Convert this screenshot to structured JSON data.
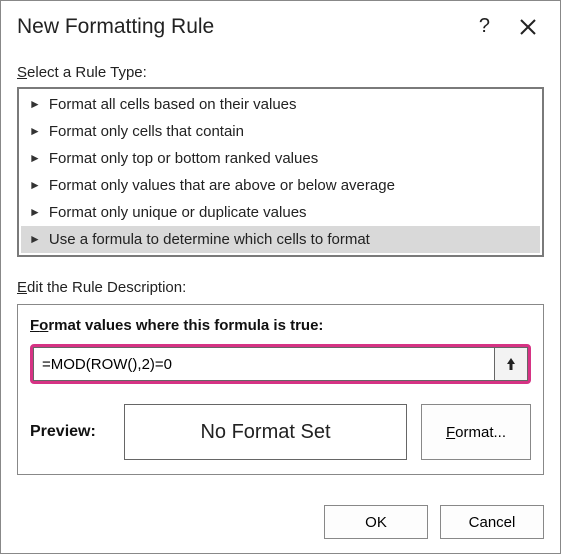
{
  "titlebar": {
    "title": "New Formatting Rule",
    "help": "?",
    "close_icon": "close"
  },
  "select_label_pre": "S",
  "select_label_rest": "elect a Rule Type:",
  "rule_types": [
    {
      "text": "Format all cells based on their values",
      "selected": false
    },
    {
      "text": "Format only cells that contain",
      "selected": false
    },
    {
      "text": "Format only top or bottom ranked values",
      "selected": false
    },
    {
      "text": "Format only values that are above or below average",
      "selected": false
    },
    {
      "text": "Format only unique or duplicate values",
      "selected": false
    },
    {
      "text": "Use a formula to determine which cells to format",
      "selected": true
    }
  ],
  "edit_label_pre": "E",
  "edit_label_rest": "dit the Rule Description:",
  "desc_title_pre": "Format values where this formula is true:",
  "formula_value": "=MOD(ROW(),2)=0",
  "preview_label": "Preview:",
  "preview_text": "No Format Set",
  "format_btn_pre": "F",
  "format_btn_rest": "ormat...",
  "ok_label": "OK",
  "cancel_label": "Cancel"
}
